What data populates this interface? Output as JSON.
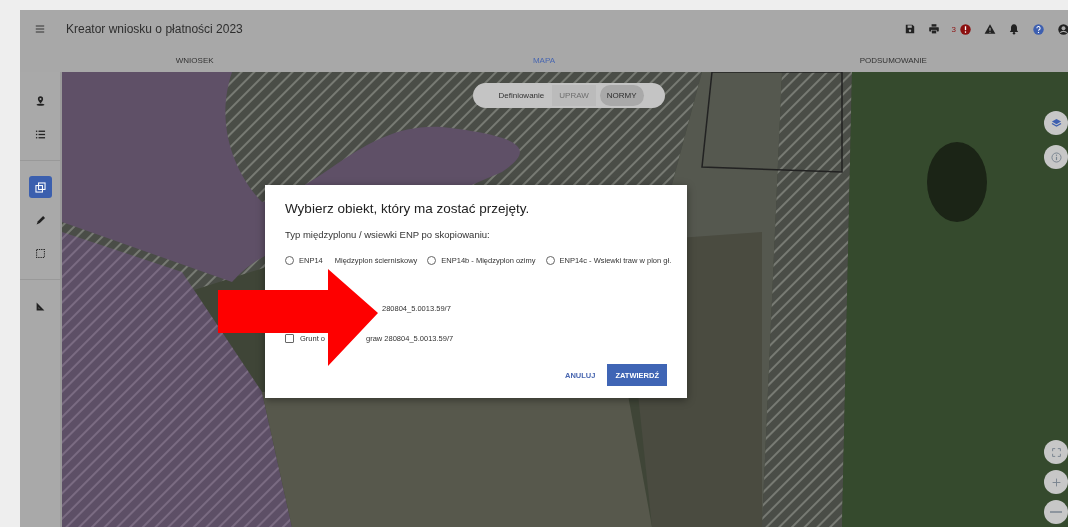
{
  "header": {
    "title": "Kreator wniosku o płatności 2023",
    "error_count": "3"
  },
  "tabs": [
    {
      "label": "WNIOSEK",
      "selected": false
    },
    {
      "label": "MAPA",
      "selected": true
    },
    {
      "label": "PODSUMOWANIE",
      "selected": false
    }
  ],
  "toolbar": {
    "tools": [
      {
        "kind": "pin",
        "selected": false
      },
      {
        "kind": "list",
        "selected": false
      },
      {
        "kind": "divider"
      },
      {
        "kind": "copy",
        "selected": true
      },
      {
        "kind": "pencil",
        "selected": false
      },
      {
        "kind": "select",
        "selected": false
      },
      {
        "kind": "divider"
      },
      {
        "kind": "ruler",
        "selected": false
      }
    ]
  },
  "mode_toggle": {
    "label": "Definiowanie",
    "options": [
      {
        "label": "UPRAW",
        "selected": false
      },
      {
        "label": "NORMY",
        "selected": true
      }
    ]
  },
  "dialog": {
    "title": "Wybierz obiekt, który ma zostać przejęty.",
    "subtitle": "Typ międzyplonu / wsiewki ENP po skopiowaniu:",
    "radios": [
      {
        "parts": [
          "ENP14",
          "Międzyplon ścierniskowy"
        ],
        "selected": false
      },
      {
        "parts": [
          "ENP14b - Międzyplon ozimy"
        ],
        "selected": false
      },
      {
        "parts": [
          "ENP14c - Wsiewki traw w plon gł."
        ],
        "selected": false
      }
    ],
    "checkboxes": [
      {
        "parts": [
          "280804_5.0013.59/7"
        ]
      },
      {
        "parts": [
          "Grunt o",
          "graw 280804_5.0013.59/7"
        ],
        "checked": false
      }
    ],
    "cancel": "ANULUJ",
    "confirm": "ZATWIERDŹ"
  }
}
